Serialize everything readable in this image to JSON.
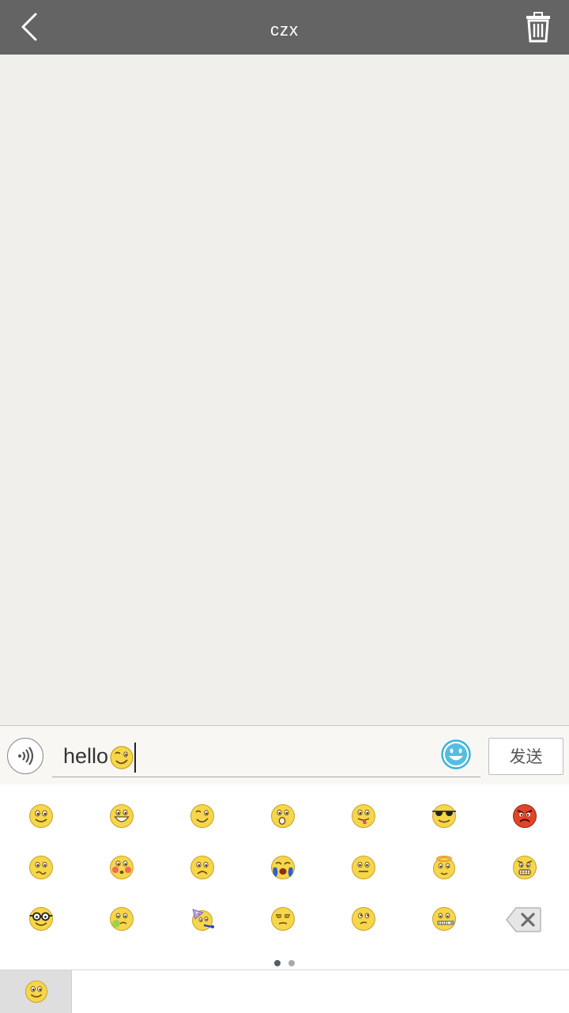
{
  "header": {
    "title": "czx",
    "back_icon": "chevron-left-icon",
    "delete_icon": "trash-icon"
  },
  "input_bar": {
    "voice_icon": "voice-icon",
    "text_value": "hello",
    "inline_emoji": "wink-emoji",
    "emoji_toggle_icon": "smiley-icon",
    "send_label": "发送"
  },
  "emoji_panel": {
    "rows": [
      [
        "smile",
        "grin",
        "wink",
        "surprised",
        "tongue",
        "cool-sunglasses",
        "angry"
      ],
      [
        "worried",
        "blush",
        "frown",
        "crying",
        "neutral",
        "angel",
        "grimace"
      ],
      [
        "nerd-glasses",
        "sick",
        "party",
        "smug",
        "confused",
        "zipped-mouth",
        "backspace"
      ]
    ],
    "page_count": 2,
    "active_page": 1
  },
  "bottom_tabs": [
    {
      "name": "smiley-category",
      "icon": "smiley-icon",
      "selected": true
    }
  ],
  "colors": {
    "header_bg": "#646464",
    "chat_bg": "#f0efeb",
    "emoji_yellow": "#f6d64a",
    "accent_blue": "#3ab3d6"
  }
}
